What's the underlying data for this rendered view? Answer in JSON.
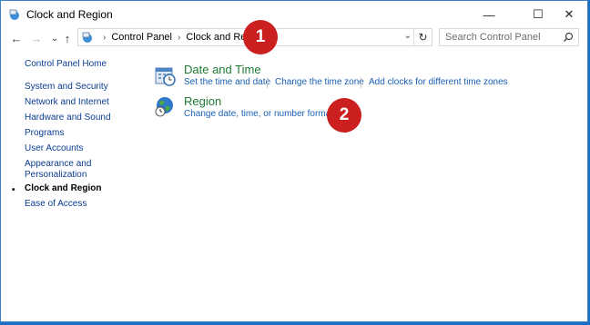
{
  "window": {
    "title": "Clock and Region",
    "minimize": "—",
    "maximize": "☐",
    "close": "✕"
  },
  "nav": {
    "back": "←",
    "forward": "→",
    "recent": "⌄",
    "up": "↑"
  },
  "address": {
    "crumbs": [
      "Control Panel",
      "Clock and Region"
    ],
    "separator": "›",
    "dropdown": "⌄",
    "refresh": "↻"
  },
  "search": {
    "placeholder": "Search Control Panel"
  },
  "sidebar": {
    "home": "Control Panel Home",
    "items": [
      "System and Security",
      "Network and Internet",
      "Hardware and Sound",
      "Programs",
      "User Accounts",
      "Appearance and",
      "Personalization",
      "Clock and Region",
      "Ease of Access"
    ],
    "active_bullet": "•"
  },
  "categories": {
    "datetime": {
      "title": "Date and Time",
      "links": [
        "Set the time and date",
        "Change the time zone",
        "Add clocks for different time zones"
      ]
    },
    "region": {
      "title": "Region",
      "links": [
        "Change date, time, or number formats"
      ]
    }
  },
  "markers": [
    "1",
    "2"
  ],
  "colors": {
    "category_title": "#1e7a34",
    "link": "#1a5fb4",
    "marker": "#cc1f1f",
    "desktop": "#1a6fc4"
  }
}
